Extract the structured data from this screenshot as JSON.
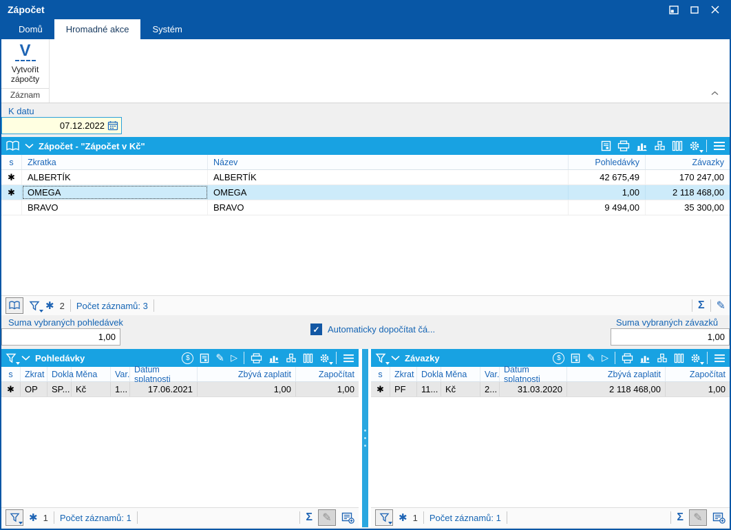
{
  "window": {
    "title": "Zápočet"
  },
  "tabs": {
    "domu": "Domů",
    "hromadne": "Hromadné akce",
    "system": "Systém"
  },
  "ribbon": {
    "create_icon_letter": "V",
    "create_label": "Vytvořit zápočty",
    "group": "Záznam"
  },
  "toolbar_date": {
    "label": "K datu",
    "value": "07.12.2022"
  },
  "icons": {
    "flag": "✱",
    "sigma": "Σ",
    "pencil": "✎",
    "play": "▷",
    "check": "✓",
    "currency": "$"
  },
  "main_panel": {
    "title": "Zápočet - \"Zápočet v Kč\"",
    "columns": {
      "s": "s",
      "zkratka": "Zkratka",
      "nazev": "Název",
      "pohledavky": "Pohledávky",
      "zavazky": "Závazky"
    },
    "rows": [
      {
        "flag": "✱",
        "zkratka": "ALBERTÍK",
        "nazev": "ALBERTÍK",
        "pohledavky": "42 675,49",
        "zavazky": "170 247,00"
      },
      {
        "flag": "✱",
        "zkratka": "OMEGA",
        "nazev": "OMEGA",
        "pohledavky": "1,00",
        "zavazky": "2 118 468,00"
      },
      {
        "flag": "",
        "zkratka": "BRAVO",
        "nazev": "BRAVO",
        "pohledavky": "9 494,00",
        "zavazky": "35 300,00"
      }
    ],
    "status": {
      "flag_count": "2",
      "records": "Počet záznamů: 3"
    }
  },
  "sums": {
    "pohledavky_label": "Suma vybraných pohledávek",
    "pohledavky_value": "1,00",
    "checkbox_label": "Automaticky dopočítat čá...",
    "zavazky_label": "Suma vybraných závazků",
    "zavazky_value": "1,00"
  },
  "shared": {
    "columns": {
      "s": "s",
      "zkrat": "Zkrat",
      "doklad": "Dokla",
      "mena": "Měna",
      "var": "Var.",
      "datum": "Datum splatnosti",
      "zbyva": "Zbývá zaplatit",
      "zapocitat": "Započítat"
    }
  },
  "panels": {
    "pohledavky": {
      "title": "Pohledávky",
      "row": {
        "flag": "✱",
        "zkrat": "OP",
        "doklad": "SP...",
        "mena": "Kč",
        "var": "1...",
        "datum": "17.06.2021",
        "zbyva": "1,00",
        "zapocitat": "1,00"
      },
      "status": {
        "flag_count": "1",
        "records": "Počet záznamů: 1"
      }
    },
    "zavazky": {
      "title": "Závazky",
      "row": {
        "flag": "✱",
        "zkrat": "PF",
        "doklad": "11...",
        "mena": "Kč",
        "var": "2...",
        "datum": "31.03.2020",
        "zbyva": "2 118 468,00",
        "zapocitat": "1,00"
      },
      "status": {
        "flag_count": "1",
        "records": "Počet záznamů: 1"
      }
    }
  }
}
